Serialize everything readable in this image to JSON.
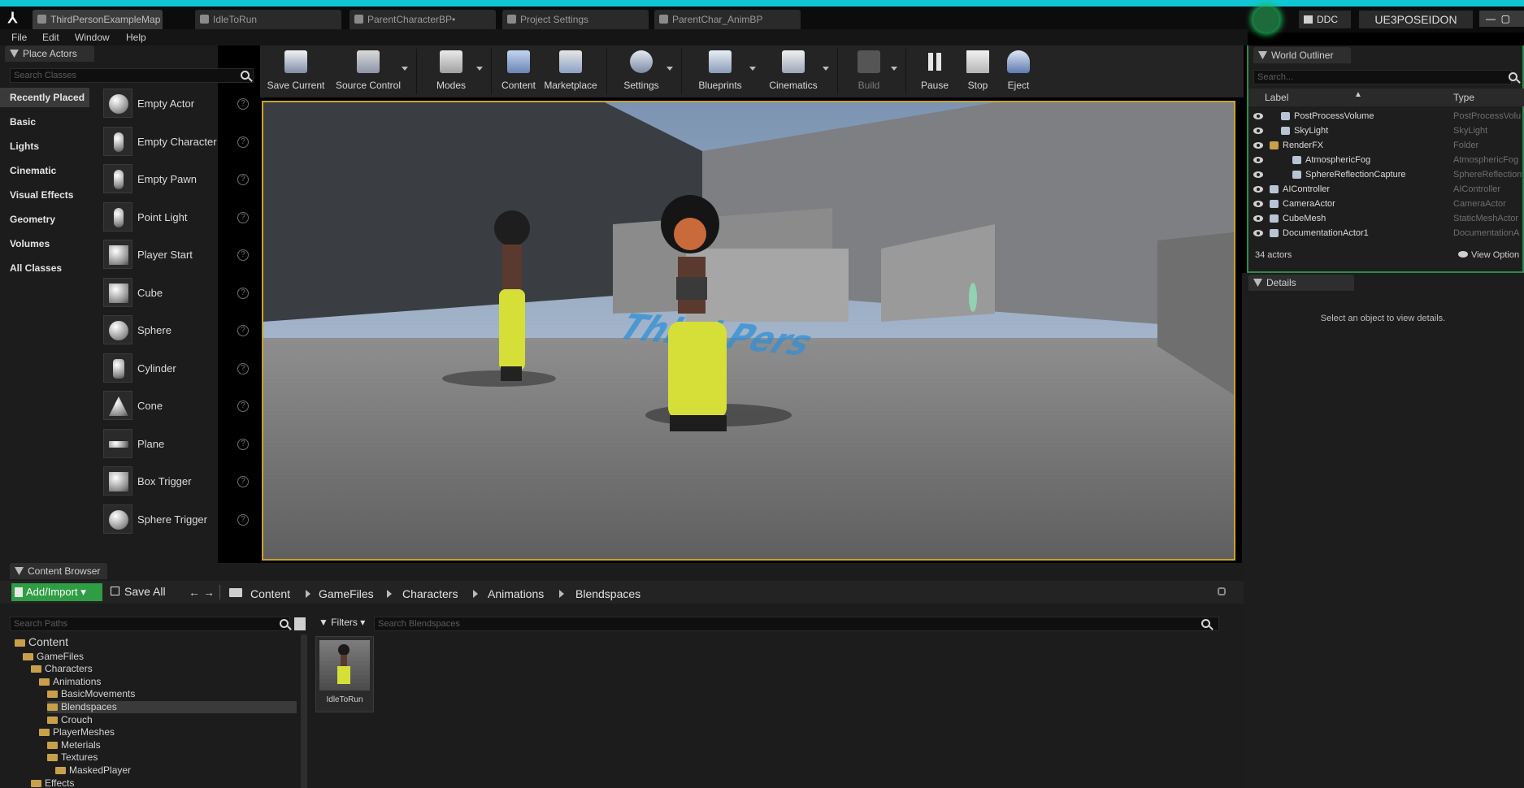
{
  "window_tabs": [
    {
      "label": "ThirdPersonExampleMap"
    },
    {
      "label": "IdleToRun"
    },
    {
      "label": "ParentCharacterBP•"
    },
    {
      "label": "Project Settings"
    },
    {
      "label": "ParentChar_AnimBP"
    }
  ],
  "top_right": {
    "ddc_label": "DDC",
    "user": "UE3POSEIDON"
  },
  "menu": [
    "File",
    "Edit",
    "Window",
    "Help"
  ],
  "place_actors": {
    "tab": "Place Actors",
    "search_placeholder": "Search Classes",
    "categories": [
      "Recently Placed",
      "Basic",
      "Lights",
      "Cinematic",
      "Visual Effects",
      "Geometry",
      "Volumes",
      "All Classes"
    ],
    "items": [
      "Empty Actor",
      "Empty Character",
      "Empty Pawn",
      "Point Light",
      "Player Start",
      "Cube",
      "Sphere",
      "Cylinder",
      "Cone",
      "Plane",
      "Box Trigger",
      "Sphere Trigger"
    ]
  },
  "toolbar": {
    "buttons": [
      "Save Current",
      "Source Control",
      "Modes",
      "Content",
      "Marketplace",
      "Settings",
      "Blueprints",
      "Cinematics",
      "Build",
      "Pause",
      "Stop",
      "Eject"
    ]
  },
  "viewport": {
    "floor_text": "Third Pers"
  },
  "world_outliner": {
    "tab": "World Outliner",
    "search_placeholder": "Search...",
    "col_label": "Label",
    "col_type": "Type",
    "rows": [
      {
        "label": "PostProcessVolume",
        "type": "PostProcessVolu"
      },
      {
        "label": "SkyLight",
        "type": "SkyLight"
      },
      {
        "label": "RenderFX",
        "type": "Folder"
      },
      {
        "label": "AtmosphericFog",
        "type": "AtmosphericFog"
      },
      {
        "label": "SphereReflectionCapture",
        "type": "SphereReflection"
      },
      {
        "label": "AIController",
        "type": "AIController"
      },
      {
        "label": "CameraActor",
        "type": "CameraActor"
      },
      {
        "label": "CubeMesh",
        "type": "StaticMeshActor"
      },
      {
        "label": "DocumentationActor1",
        "type": "DocumentationA"
      }
    ],
    "count": "34 actors",
    "view_options": "View Option"
  },
  "details": {
    "tab": "Details",
    "empty_text": "Select an object to view details."
  },
  "content_browser": {
    "tab": "Content Browser",
    "add_import": "Add/Import",
    "save_all": "Save All",
    "breadcrumb": [
      "Content",
      "GameFiles",
      "Characters",
      "Animations",
      "Blendspaces"
    ],
    "search_paths_placeholder": "Search Paths",
    "filters": "Filters",
    "search_assets_placeholder": "Search Blendspaces",
    "tree": [
      "Content",
      "GameFiles",
      "Characters",
      "Animations",
      "BasicMovements",
      "Blendspaces",
      "Crouch",
      "PlayerMeshes",
      "Meterials",
      "Textures",
      "MaskedPlayer",
      "Effects"
    ],
    "asset": "IdleToRun"
  }
}
